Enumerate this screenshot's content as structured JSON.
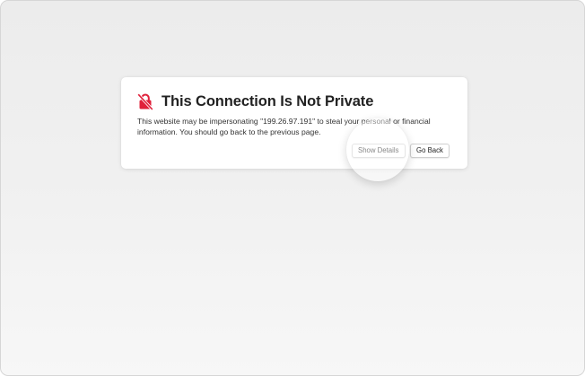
{
  "dialog": {
    "icon": "crossed-lock-icon",
    "title": "This Connection Is Not Private",
    "message_line1": "This website may be impersonating \"199.26.97.191\" to steal your personal or financial",
    "message_line2": "information. You should go back to the previous page.",
    "show_details_label": "Show Details",
    "go_back_label": "Go Back"
  },
  "colors": {
    "warning_icon": "#e0203a",
    "title_text": "#222222",
    "background": "#efefef"
  }
}
